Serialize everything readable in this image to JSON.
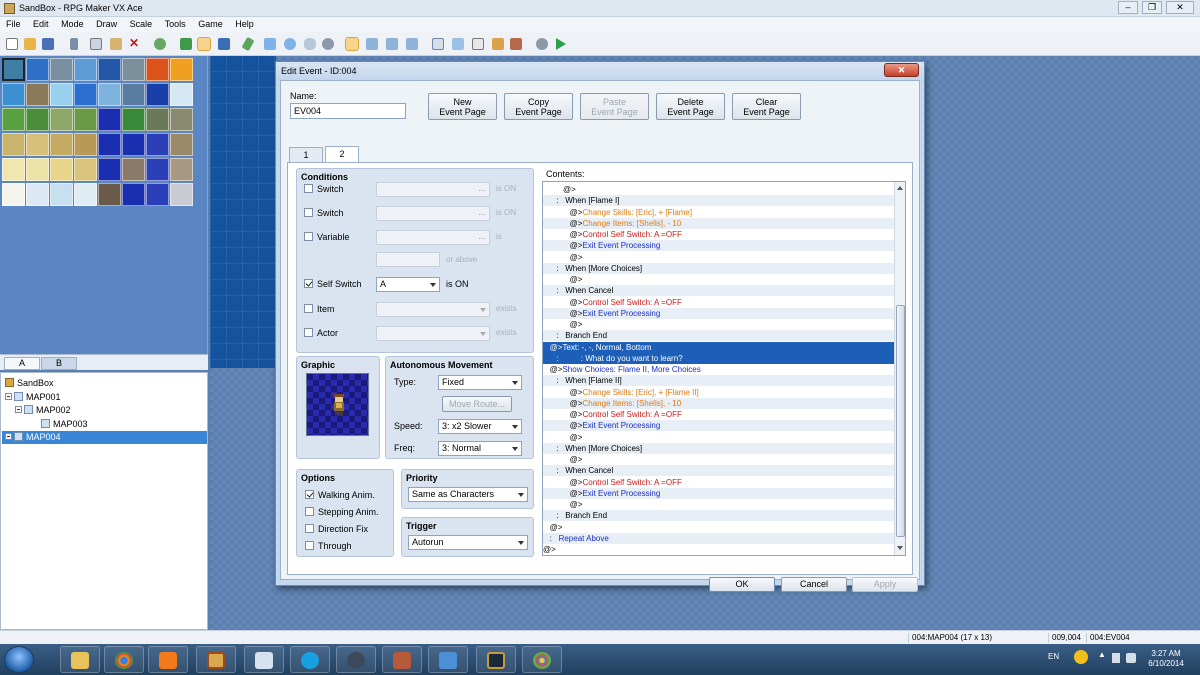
{
  "window": {
    "title": "SandBox - RPG Maker VX Ace",
    "minimize": "–",
    "maximize": "❐",
    "close": "✕"
  },
  "menu": [
    "File",
    "Edit",
    "Mode",
    "Draw",
    "Scale",
    "Tools",
    "Game",
    "Help"
  ],
  "toolbar_icons": [
    "new-project-icon",
    "open-project-icon",
    "save-project-icon",
    "cut-icon",
    "copy-icon",
    "paste-icon",
    "delete-icon",
    "undo-icon",
    "map-mode-icon",
    "event-mode-icon",
    "region-mode-icon",
    "pencil-icon",
    "rectangle-icon",
    "ellipse-icon",
    "flood-fill-icon",
    "shadow-pen-icon",
    "zoom-1-1-icon",
    "zoom-1-2-icon",
    "zoom-1-4-icon",
    "zoom-1-8-icon",
    "database-icon",
    "resource-manager-icon",
    "script-editor-icon",
    "sound-test-icon",
    "character-generator-icon",
    "options-icon",
    "playtest-icon"
  ],
  "tileset_tabs": [
    "A",
    "B"
  ],
  "map_tree": [
    {
      "label": "SandBox",
      "level": 0,
      "selected": false
    },
    {
      "label": "MAP001",
      "level": 0,
      "selected": false
    },
    {
      "label": "MAP002",
      "level": 1,
      "selected": false
    },
    {
      "label": "MAP003",
      "level": 2,
      "selected": false
    },
    {
      "label": "MAP004",
      "level": 0,
      "selected": true
    }
  ],
  "statusbar": {
    "map": "004:MAP004 (17 x 13)",
    "coords": "009,004",
    "event": "004:EV004"
  },
  "taskbar": {
    "lang": "EN",
    "time": "3:27 AM",
    "date": "6/10/2014"
  },
  "dialog": {
    "title": "Edit Event - ID:004",
    "close": "✕",
    "name_label": "Name:",
    "name_value": "EV004",
    "buttons": {
      "new": "New\nEvent Page",
      "copy": "Copy\nEvent Page",
      "paste": "Paste\nEvent Page",
      "delete": "Delete\nEvent Page",
      "clear": "Clear\nEvent Page"
    },
    "page_tabs": [
      "1",
      "2"
    ],
    "conditions": {
      "title": "Conditions",
      "switch": "Switch",
      "switch2": "Switch",
      "variable": "Variable",
      "is_on": "is ON",
      "is": "is",
      "or_above": "or above",
      "self_switch": "Self Switch",
      "self_switch_value": "A",
      "self_is_on": "is ON",
      "item": "Item",
      "actor": "Actor",
      "exists": "exists"
    },
    "graphic_title": "Graphic",
    "movement": {
      "title": "Autonomous Movement",
      "type_label": "Type:",
      "type_value": "Fixed",
      "move_route": "Move Route...",
      "speed_label": "Speed:",
      "speed_value": "3: x2 Slower",
      "freq_label": "Freq:",
      "freq_value": "3: Normal"
    },
    "options": {
      "title": "Options",
      "walking": "Walking Anim.",
      "stepping": "Stepping Anim.",
      "direction": "Direction Fix",
      "through": "Through"
    },
    "priority": {
      "title": "Priority",
      "value": "Same as Characters"
    },
    "trigger": {
      "title": "Trigger",
      "value": "Autorun"
    },
    "contents_label": "Contents:",
    "contents": [
      {
        "segs": [
          {
            "t": "         @>",
            "c": "def"
          }
        ]
      },
      {
        "segs": [
          {
            "t": "      :   When [Flame I]",
            "c": "def"
          }
        ]
      },
      {
        "segs": [
          {
            "t": "            @>",
            "c": "def"
          },
          {
            "t": "Change Skills: [Eric], + [Flame]",
            "c": "orange"
          }
        ]
      },
      {
        "segs": [
          {
            "t": "            @>",
            "c": "def"
          },
          {
            "t": "Change Items: [Shells], - 10",
            "c": "orange"
          }
        ]
      },
      {
        "segs": [
          {
            "t": "            @>",
            "c": "def"
          },
          {
            "t": "Control Self Switch: A =OFF",
            "c": "red"
          }
        ]
      },
      {
        "segs": [
          {
            "t": "            @>",
            "c": "def"
          },
          {
            "t": "Exit Event Processing",
            "c": "blue"
          }
        ]
      },
      {
        "segs": [
          {
            "t": "            @>",
            "c": "def"
          }
        ]
      },
      {
        "segs": [
          {
            "t": "      :   When [More Choices]",
            "c": "def"
          }
        ]
      },
      {
        "segs": [
          {
            "t": "            @>",
            "c": "def"
          }
        ]
      },
      {
        "segs": [
          {
            "t": "      :   When Cancel",
            "c": "def"
          }
        ]
      },
      {
        "segs": [
          {
            "t": "            @>",
            "c": "def"
          },
          {
            "t": "Control Self Switch: A =OFF",
            "c": "red"
          }
        ]
      },
      {
        "segs": [
          {
            "t": "            @>",
            "c": "def"
          },
          {
            "t": "Exit Event Processing",
            "c": "blue"
          }
        ]
      },
      {
        "segs": [
          {
            "t": "            @>",
            "c": "def"
          }
        ]
      },
      {
        "segs": [
          {
            "t": "      :   Branch End",
            "c": "def"
          }
        ]
      },
      {
        "segs": [
          {
            "t": "   @>Text: -, -, Normal, Bottom",
            "c": "blue"
          }
        ],
        "selected": true
      },
      {
        "segs": [
          {
            "t": "      :          : What do you want to learn?",
            "c": "blue"
          }
        ],
        "selected": true
      },
      {
        "segs": [
          {
            "t": "   @>",
            "c": "def"
          },
          {
            "t": "Show Choices: Flame II, More Choices",
            "c": "blue"
          }
        ]
      },
      {
        "segs": [
          {
            "t": "      :   When [Flame II]",
            "c": "def"
          }
        ]
      },
      {
        "segs": [
          {
            "t": "            @>",
            "c": "def"
          },
          {
            "t": "Change Skills: [Eric], + [Flame II]",
            "c": "orange"
          }
        ]
      },
      {
        "segs": [
          {
            "t": "            @>",
            "c": "def"
          },
          {
            "t": "Change Items: [Shells], - 10",
            "c": "orange"
          }
        ]
      },
      {
        "segs": [
          {
            "t": "            @>",
            "c": "def"
          },
          {
            "t": "Control Self Switch: A =OFF",
            "c": "red"
          }
        ]
      },
      {
        "segs": [
          {
            "t": "            @>",
            "c": "def"
          },
          {
            "t": "Exit Event Processing",
            "c": "blue"
          }
        ]
      },
      {
        "segs": [
          {
            "t": "            @>",
            "c": "def"
          }
        ]
      },
      {
        "segs": [
          {
            "t": "      :   When [More Choices]",
            "c": "def"
          }
        ]
      },
      {
        "segs": [
          {
            "t": "            @>",
            "c": "def"
          }
        ]
      },
      {
        "segs": [
          {
            "t": "      :   When Cancel",
            "c": "def"
          }
        ]
      },
      {
        "segs": [
          {
            "t": "            @>",
            "c": "def"
          },
          {
            "t": "Control Self Switch: A =OFF",
            "c": "red"
          }
        ]
      },
      {
        "segs": [
          {
            "t": "            @>",
            "c": "def"
          },
          {
            "t": "Exit Event Processing",
            "c": "blue"
          }
        ]
      },
      {
        "segs": [
          {
            "t": "            @>",
            "c": "def"
          }
        ]
      },
      {
        "segs": [
          {
            "t": "      :   Branch End",
            "c": "def"
          }
        ]
      },
      {
        "segs": [
          {
            "t": "   @>",
            "c": "def"
          }
        ]
      },
      {
        "segs": [
          {
            "t": "   :   ",
            "c": "def"
          },
          {
            "t": "Repeat Above",
            "c": "blue"
          }
        ]
      },
      {
        "segs": [
          {
            "t": "@>",
            "c": "def"
          }
        ]
      }
    ],
    "ok": "OK",
    "cancel": "Cancel",
    "apply": "Apply"
  }
}
